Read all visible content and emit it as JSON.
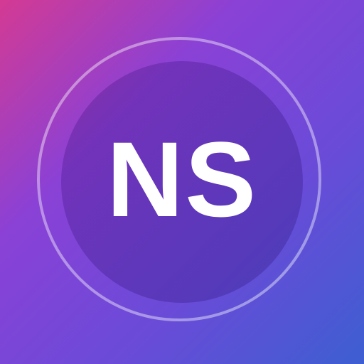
{
  "logo": {
    "initials": "NS"
  },
  "colors": {
    "gradient_start": "#d43a93",
    "gradient_mid": "#8a41d6",
    "gradient_end": "#3d5fd1",
    "text": "#ffffff"
  }
}
